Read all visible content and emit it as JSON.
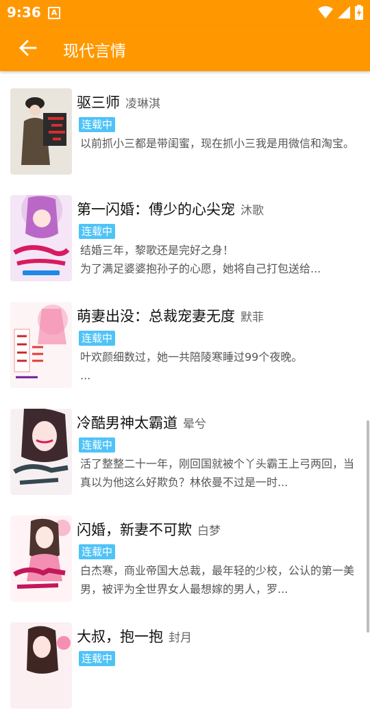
{
  "status": {
    "time": "9:36",
    "notification": "A"
  },
  "appbar": {
    "title": "现代言情"
  },
  "books": [
    {
      "title": "驱三师",
      "author": "凌琳淇",
      "status": "连载中",
      "desc": "以前抓小三都是带闺蜜，现在抓小三我是用微信和淘宝。"
    },
    {
      "title": "第一闪婚：傅少的心尖宠",
      "author": "沐歌",
      "status": "连载中",
      "desc": "结婚三年，黎歌还是完好之身！\n 为了满足婆婆抱孙子的心愿，她将自己打包送给..."
    },
    {
      "title": "萌妻出没：总裁宠妻无度",
      "author": "默菲",
      "status": "连载中",
      "desc": "叶欢颜细数过，她一共陪陵寒睡过99个夜晚。\n..."
    },
    {
      "title": "冷酷男神太霸道",
      "author": "晕兮",
      "status": "连载中",
      "desc": "活了整整二十一年，刚回国就被个丫头霸王上弓两回，当真以为他这么好欺负？林依曼不过是一时..."
    },
    {
      "title": "闪婚，新妻不可欺",
      "author": "白梦",
      "status": "连载中",
      "desc": "白杰寒，商业帝国大总裁，最年轻的少校，公认的第一美男，被评为全世界女人最想嫁的男人，罗..."
    },
    {
      "title": "大叔，抱一抱",
      "author": "封月",
      "status": "连载中",
      "desc": ""
    }
  ]
}
